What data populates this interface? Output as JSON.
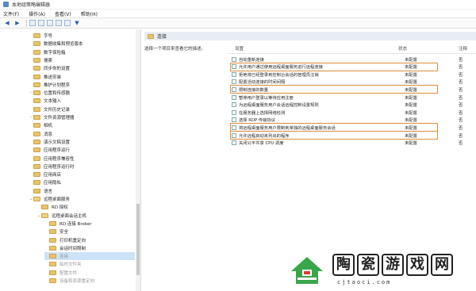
{
  "window": {
    "title": "本地组策略编辑器"
  },
  "menu": [
    "文件(F)",
    "操作(A)",
    "查看(V)",
    "帮助(H)"
  ],
  "tree": [
    {
      "label": "字号",
      "depth": 3,
      "folder": true
    },
    {
      "label": "数据收集和预览版本",
      "depth": 3,
      "folder": true
    },
    {
      "label": "数字保险箱",
      "depth": 3,
      "folder": true
    },
    {
      "label": "搜索",
      "depth": 3,
      "folder": true
    },
    {
      "label": "同步你的设置",
      "depth": 3,
      "folder": true
    },
    {
      "label": "推送安装",
      "depth": 3,
      "folder": true
    },
    {
      "label": "推护计划程序",
      "depth": 3,
      "folder": true
    },
    {
      "label": "位置和传感器",
      "depth": 3,
      "folder": true,
      "expander": "›"
    },
    {
      "label": "文本输入",
      "depth": 3,
      "folder": true
    },
    {
      "label": "文件历史记录",
      "depth": 3,
      "folder": true
    },
    {
      "label": "文件资源管理器",
      "depth": 3,
      "folder": true,
      "expander": "›"
    },
    {
      "label": "相机",
      "depth": 3,
      "folder": true
    },
    {
      "label": "消息",
      "depth": 3,
      "folder": true
    },
    {
      "label": "演示文稿设置",
      "depth": 3,
      "folder": true
    },
    {
      "label": "应用程序运行",
      "depth": 3,
      "folder": true
    },
    {
      "label": "应用程序兼容性",
      "depth": 3,
      "folder": true
    },
    {
      "label": "应用程序运行时",
      "depth": 3,
      "folder": true
    },
    {
      "label": "应用商店",
      "depth": 3,
      "folder": true
    },
    {
      "label": "应用隐私",
      "depth": 3,
      "folder": true
    },
    {
      "label": "语言",
      "depth": 3,
      "folder": true
    },
    {
      "label": "远程桌面服务",
      "depth": 3,
      "folder": true,
      "expander": "⌄",
      "open": true
    },
    {
      "label": "RD 授权",
      "depth": 4,
      "folder": true
    },
    {
      "label": "远程桌面会话主机",
      "depth": 4,
      "folder": true,
      "expander": "⌄",
      "open": true
    },
    {
      "label": "RD 连接 Broker",
      "depth": 5,
      "folder": true
    },
    {
      "label": "安全",
      "depth": 5,
      "folder": true
    },
    {
      "label": "打印机重定向",
      "depth": 5,
      "folder": true
    },
    {
      "label": "会话时间限制",
      "depth": 5,
      "folder": true
    },
    {
      "label": "连接",
      "depth": 5,
      "folder": true,
      "selected": true,
      "faded": true
    },
    {
      "label": "临时文件夹",
      "depth": 5,
      "folder": true,
      "faded": true
    },
    {
      "label": "配置文件",
      "depth": 5,
      "folder": true,
      "faded": true
    },
    {
      "label": "设备和资源重定向",
      "depth": 5,
      "folder": true,
      "faded": true
    }
  ],
  "right": {
    "header": "连接",
    "description": "选择一个项目来查看它的描述。",
    "columns": {
      "setting": "设置",
      "state": "状态",
      "note": "注释"
    },
    "rows": [
      {
        "name": "自动重新连接",
        "state": "未配置",
        "note": "否"
      },
      {
        "name": "允许用户通过使用远程桌面服务进行远程连接",
        "state": "未配置",
        "note": "否",
        "highlight": true
      },
      {
        "name": "拒绝将已经登录到控制台会话的管理员注销",
        "state": "未配置",
        "note": "否"
      },
      {
        "name": "配置活动连接的时间间隔",
        "state": "未配置",
        "note": "否"
      },
      {
        "name": "限制连接的数量",
        "state": "未配置",
        "note": "否",
        "highlight": true
      },
      {
        "name": "暂停用户登录以等待应用注册",
        "state": "未配置",
        "note": "否"
      },
      {
        "name": "为远程桌面服务用户会话远程控制设置规则",
        "state": "未配置",
        "note": "否"
      },
      {
        "name": "在服务器上选择网络检测",
        "state": "未配置",
        "note": "否"
      },
      {
        "name": "选择 RDP 传输协议",
        "state": "未配置",
        "note": "否"
      },
      {
        "name": "将远程桌面服务用户限制到单独的远程桌面服务会话",
        "state": "未配置",
        "note": "否",
        "highlight": true
      },
      {
        "name": "允许远程启动未列出的程序",
        "state": "未配置",
        "note": "否",
        "highlight": true
      },
      {
        "name": "关闭公平共享 CPU 调度",
        "state": "未配置",
        "note": "否"
      }
    ]
  },
  "watermark": {
    "chars": [
      "陶",
      "瓷",
      "游",
      "戏",
      "网"
    ],
    "url": "cjtaoci.com"
  },
  "colors": {
    "highlight": "#e08a3c",
    "selected": "#cde3f7",
    "green": "#3aa64b",
    "red": "#d63c2f"
  }
}
